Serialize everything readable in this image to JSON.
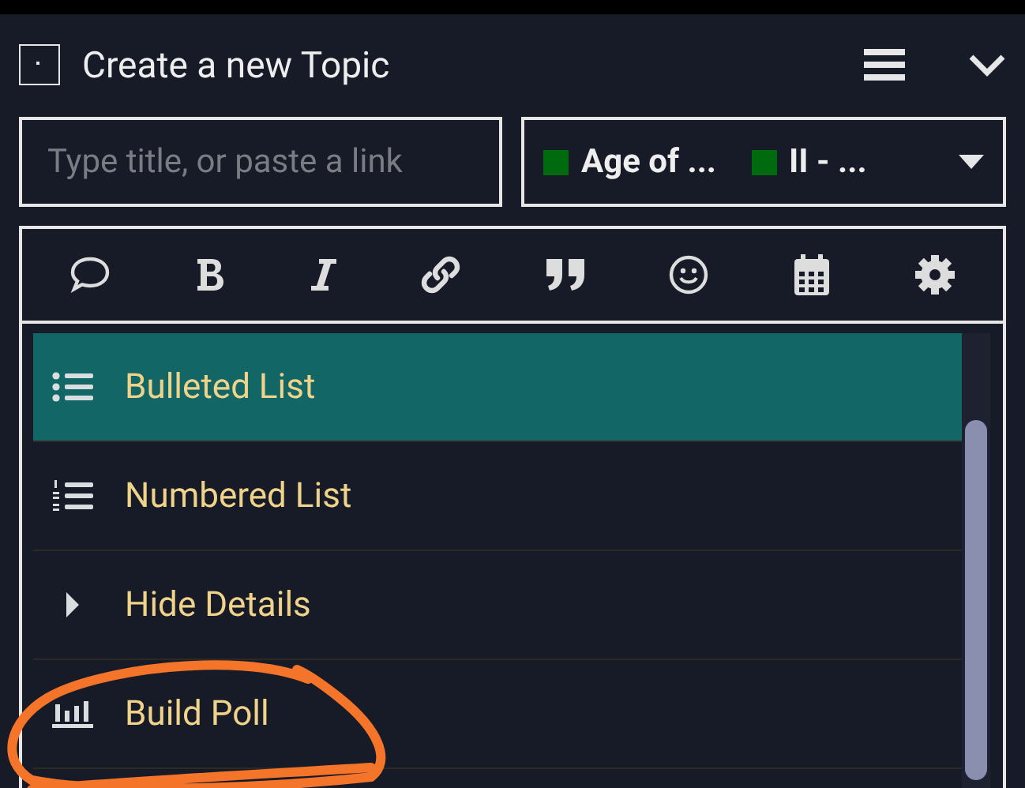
{
  "header": {
    "title": "Create a new Topic"
  },
  "title_field": {
    "placeholder": "Type title, or paste a link"
  },
  "category_chooser": {
    "tags": [
      {
        "label": "Age of ...",
        "color": "#006b0e"
      },
      {
        "label": "II - ...",
        "color": "#006b0e"
      }
    ]
  },
  "toolbar": {
    "tools": [
      {
        "kind": "chat"
      },
      {
        "kind": "bold"
      },
      {
        "kind": "italic"
      },
      {
        "kind": "link"
      },
      {
        "kind": "quote"
      },
      {
        "kind": "emoji"
      },
      {
        "kind": "calendar"
      },
      {
        "kind": "gear"
      }
    ]
  },
  "menu": {
    "items": [
      {
        "kind": "bullet",
        "label": "Bulleted List",
        "selected": true
      },
      {
        "kind": "numbered",
        "label": "Numbered List",
        "selected": false
      },
      {
        "kind": "details",
        "label": "Hide Details",
        "selected": false
      },
      {
        "kind": "poll",
        "label": "Build Poll",
        "selected": false
      }
    ]
  }
}
